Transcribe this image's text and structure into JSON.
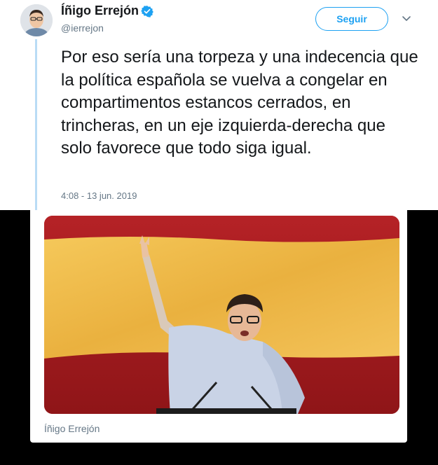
{
  "tweet": {
    "author_name": "Íñigo Errejón",
    "handle": "@ierrejon",
    "verified": true,
    "follow_label": "Seguir",
    "text": "Por eso sería una torpeza y una indecencia que la política española se vuelva a congelar en compartimentos estancos cerrados, en trincheras, en un eje izquierda-derecha que solo favorece que todo siga igual.",
    "timestamp": "4:08 - 13 jun. 2019"
  },
  "card": {
    "source_label": "Íñigo Errejón"
  },
  "icons": {
    "verified": "verified-badge-icon",
    "menu": "chevron-down-icon"
  },
  "colors": {
    "accent": "#1da1f2",
    "thread_line": "#b9dcf5",
    "flag_red": "#a51c1e",
    "flag_yellow": "#f2c14e",
    "text_primary": "#14171a",
    "text_secondary": "#657786"
  }
}
